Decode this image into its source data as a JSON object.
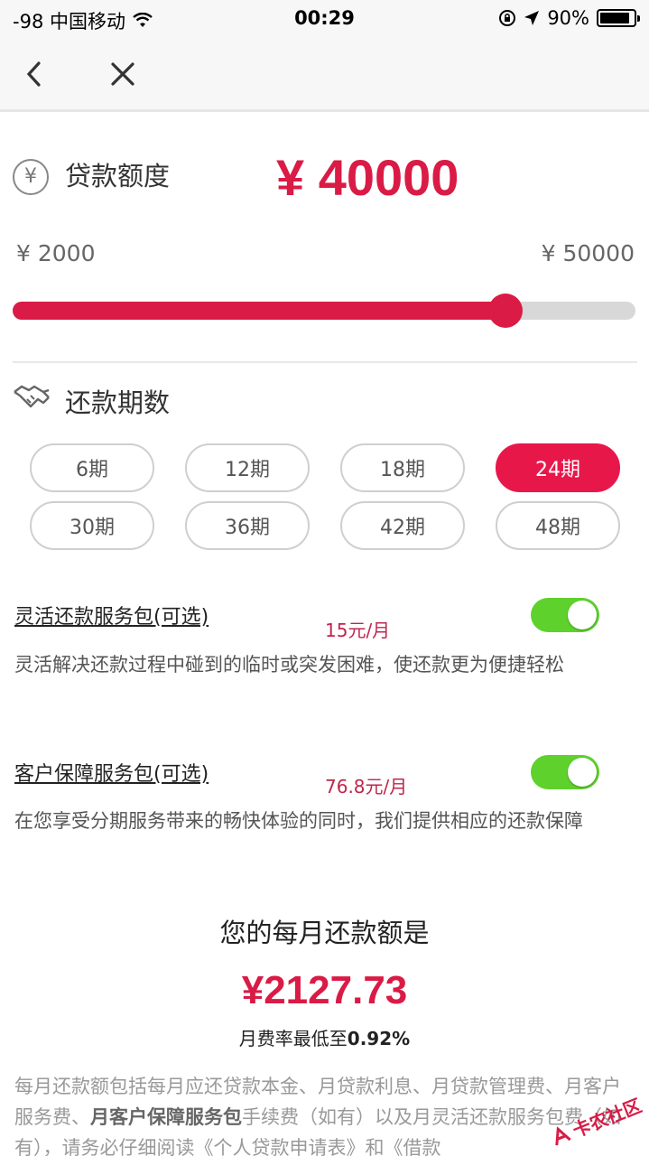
{
  "status_bar": {
    "carrier": "-98 中国移动",
    "time": "00:29",
    "battery": "90%",
    "battery_level": 0.9
  },
  "loan": {
    "currency_icon": "¥",
    "label": "贷款额度",
    "amount": "¥ 40000",
    "min_label": "¥ 2000",
    "max_label": "¥ 50000",
    "slider_value": 40000,
    "slider_min": 2000,
    "slider_max": 50000
  },
  "term": {
    "label": "还款期数",
    "options": [
      "6期",
      "12期",
      "18期",
      "24期",
      "30期",
      "36期",
      "42期",
      "48期"
    ],
    "selected": "24期"
  },
  "packages": [
    {
      "title": "灵活还款服务包(可选)",
      "price": "15元/月",
      "desc": "灵活解决还款过程中碰到的临时或突发困难，使还款更为便捷轻松",
      "enabled": true
    },
    {
      "title": "客户保障服务包(可选)",
      "price": "76.8元/月",
      "desc": "在您享受分期服务带来的畅快体验的同时，我们提供相应的还款保障",
      "enabled": true
    }
  ],
  "monthly": {
    "title": "您的每月还款额是",
    "value": "¥2127.73",
    "rate_prefix": "月费率最低至",
    "rate_value": "0.92%"
  },
  "note": {
    "part1": "每月还款额包括每月应还贷款本金、月贷款利息、月贷款管理费、月客户服务费、",
    "bold": "月客户保障服务包",
    "part2": "手续费（如有）以及月灵活还款服务包费（如有），请务必仔细阅读《个人贷款申请表》和《借款"
  },
  "watermark": "卡农社区",
  "colors": {
    "accent": "#d91b46",
    "toggle_on": "#5ed12c"
  }
}
